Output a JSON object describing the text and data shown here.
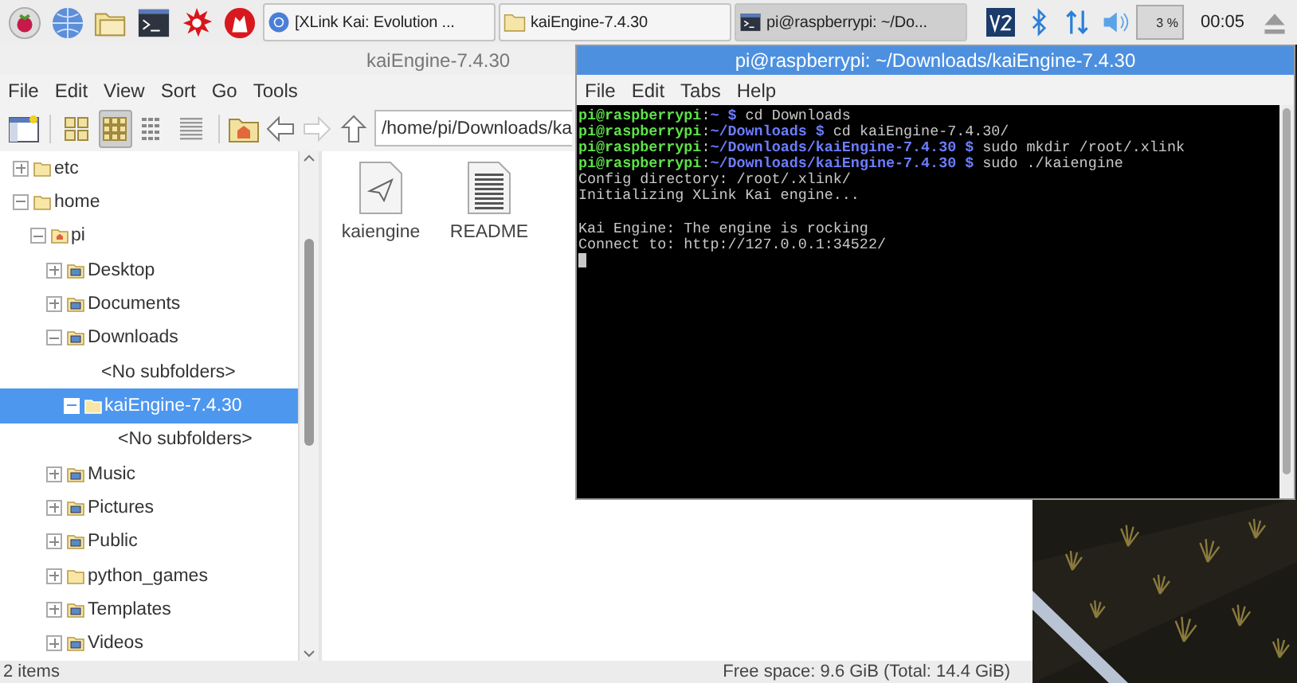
{
  "taskbar": {
    "tasks": [
      {
        "kind": "browser",
        "label": "[XLink Kai: Evolution ...",
        "selected": false
      },
      {
        "kind": "folder",
        "label": "kaiEngine-7.4.30",
        "selected": false
      },
      {
        "kind": "terminal",
        "label": "pi@raspberrypi: ~/Do...",
        "selected": true
      }
    ],
    "cpu": "3 %",
    "clock": "00:05"
  },
  "file_manager": {
    "title": "kaiEngine-7.4.30",
    "active": false,
    "menu": [
      "File",
      "Edit",
      "View",
      "Sort",
      "Go",
      "Tools"
    ],
    "view_modes": [
      {
        "selected": false
      },
      {
        "selected": true
      },
      {
        "selected": false
      },
      {
        "selected": false
      }
    ],
    "path": "/home/pi/Downloads/ka",
    "tree": [
      {
        "kind": "folder",
        "label": "etc",
        "expanded": false,
        "selected": false
      },
      {
        "kind": "folder",
        "label": "home",
        "expanded": true,
        "selected": false,
        "children": [
          {
            "kind": "home",
            "label": "pi",
            "expanded": true,
            "selected": false,
            "children": [
              {
                "kind": "special",
                "label": "Desktop",
                "expanded": false,
                "selected": false
              },
              {
                "kind": "special",
                "label": "Documents",
                "expanded": false,
                "selected": false
              },
              {
                "kind": "special",
                "label": "Downloads",
                "expanded": true,
                "selected": false,
                "children": [
                  {
                    "kind": "placeholder",
                    "label": "<No subfolders>"
                  },
                  {
                    "kind": "folder",
                    "label": "kaiEngine-7.4.30",
                    "expanded": true,
                    "selected": true,
                    "children": [
                      {
                        "kind": "placeholder",
                        "label": "<No subfolders>"
                      }
                    ]
                  }
                ]
              },
              {
                "kind": "special",
                "label": "Music",
                "expanded": false,
                "selected": false
              },
              {
                "kind": "special",
                "label": "Pictures",
                "expanded": false,
                "selected": false
              },
              {
                "kind": "special",
                "label": "Public",
                "expanded": false,
                "selected": false
              },
              {
                "kind": "folder",
                "label": "python_games",
                "expanded": false,
                "selected": false
              },
              {
                "kind": "special",
                "label": "Templates",
                "expanded": false,
                "selected": false
              },
              {
                "kind": "special",
                "label": "Videos",
                "expanded": false,
                "selected": false
              }
            ]
          }
        ]
      }
    ],
    "files": [
      {
        "kind": "executable",
        "name": "kaiengine"
      },
      {
        "kind": "text",
        "name": "README"
      }
    ],
    "status_left": "2 items",
    "status_right": "Free space: 9.6 GiB (Total: 14.4 GiB)"
  },
  "terminal": {
    "title": "pi@raspberrypi: ~/Downloads/kaiEngine-7.4.30",
    "active": true,
    "menu": [
      "File",
      "Edit",
      "Tabs",
      "Help"
    ],
    "lines": [
      {
        "kind": "prompt",
        "user": "pi@raspberrypi",
        "separator": ":",
        "path": "~",
        "symbol": "$",
        "command": "cd Downloads"
      },
      {
        "kind": "prompt",
        "user": "pi@raspberrypi",
        "separator": ":",
        "path": "~/Downloads",
        "symbol": "$",
        "command": "cd kaiEngine-7.4.30/"
      },
      {
        "kind": "prompt",
        "user": "pi@raspberrypi",
        "separator": ":",
        "path": "~/Downloads/kaiEngine-7.4.30",
        "symbol": "$",
        "command": "sudo mkdir /root/.xlink"
      },
      {
        "kind": "prompt",
        "user": "pi@raspberrypi",
        "separator": ":",
        "path": "~/Downloads/kaiEngine-7.4.30",
        "symbol": "$",
        "command": "sudo ./kaiengine"
      },
      {
        "kind": "output",
        "text": "Config directory: /root/.xlink/"
      },
      {
        "kind": "output",
        "text": "Initializing XLink Kai engine..."
      },
      {
        "kind": "blank"
      },
      {
        "kind": "output",
        "text": "Kai Engine: The engine is rocking"
      },
      {
        "kind": "output",
        "text": "Connect to: http://127.0.0.1:34522/"
      }
    ]
  }
}
